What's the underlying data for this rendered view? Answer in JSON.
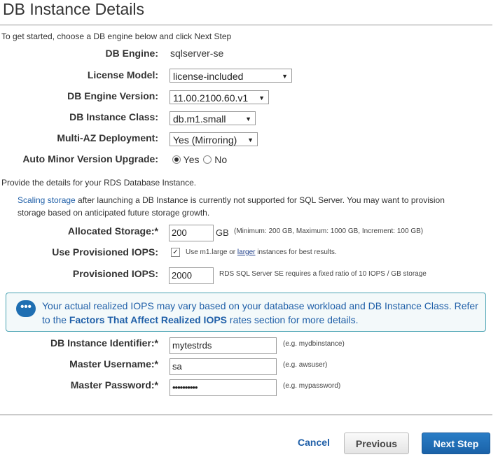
{
  "page": {
    "title": "DB Instance Details",
    "intro": "To get started, choose a DB engine below and click Next Step"
  },
  "engine": {
    "label": "DB Engine:",
    "value": "sqlserver-se"
  },
  "license": {
    "label": "License Model:",
    "value": "license-included"
  },
  "version": {
    "label": "DB Engine Version:",
    "value": "11.00.2100.60.v1"
  },
  "class": {
    "label": "DB Instance Class:",
    "value": "db.m1.small"
  },
  "multiaz": {
    "label": "Multi-AZ Deployment:",
    "value": "Yes (Mirroring)"
  },
  "minor": {
    "label": "Auto Minor Version Upgrade:",
    "yes": "Yes",
    "no": "No",
    "selected": "Yes"
  },
  "details_intro": "Provide the details for your RDS Database Instance.",
  "scaling": {
    "link": "Scaling storage",
    "text": " after launching a DB Instance is currently not supported for SQL Server. You may want to provision",
    "text2": "storage based on anticipated future storage growth."
  },
  "storage": {
    "label": "Allocated Storage:*",
    "value": "200",
    "unit": "GB",
    "hint": "(Minimum: 200 GB, Maximum: 1000 GB, Increment: 100 GB)"
  },
  "piops": {
    "label": "Use Provisioned IOPS:",
    "checked": true,
    "hint_pre": "Use m1.large or ",
    "hint_link": "larger",
    "hint_post": " instances for best results."
  },
  "iops": {
    "label": "Provisioned IOPS:",
    "value": "2000",
    "hint": "RDS SQL Server SE requires a fixed ratio of 10 IOPS / GB storage"
  },
  "info": {
    "icon": "chat-bubble-icon",
    "line1": "Your actual realized IOPS may vary based on your database workload and DB Instance Class. Refer",
    "line2_pre": "to the ",
    "line2_link": "Factors That Affect Realized IOPS",
    "line2_post": " rates section for more details."
  },
  "identifier": {
    "label": "DB Instance Identifier:*",
    "value": "mytestrds",
    "hint": "(e.g. mydbinstance)"
  },
  "username": {
    "label": "Master Username:*",
    "value": "sa",
    "hint": "(e.g. awsuser)"
  },
  "password": {
    "label": "Master Password:*",
    "value": "••••••••••",
    "hint": "(e.g. mypassword)"
  },
  "buttons": {
    "cancel": "Cancel",
    "previous": "Previous",
    "next": "Next Step"
  },
  "colors": {
    "primary": "#1a62a8",
    "link": "#1f5fa8",
    "info_border": "#4aa3b3"
  }
}
